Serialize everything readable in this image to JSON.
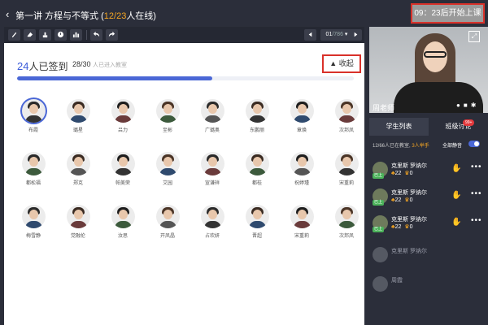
{
  "header": {
    "back_glyph": "‹",
    "title_prefix": "第一讲 方程与不等式 (",
    "online_count": "12/23",
    "title_suffix": "人在线)",
    "start_button": "09：23后开始上课"
  },
  "toolbar": {
    "tools": [
      "brush-icon",
      "eraser-icon",
      "stamp-icon",
      "timer-icon",
      "chart-icon",
      "undo-icon",
      "redo-icon"
    ],
    "page_current": "01",
    "page_total": "/786"
  },
  "board": {
    "signed_count": "24",
    "signed_label": "人已签到",
    "entered_count": "28/30",
    "entered_label": "人已进入教室",
    "collapse_label": "收起",
    "progress": 0.58,
    "students": [
      "布霞",
      "璐星",
      "吕力",
      "至彬",
      "广璐奥",
      "东鹏丽",
      "章焕",
      "次邦凤",
      "都松福",
      "郑克",
      "帕美荣",
      "艾园",
      "宣谦祥",
      "都桂",
      "祝婷瑾",
      "宋重莉",
      "梅雪静",
      "党融伦",
      "汝思",
      "开凤晶",
      "占欢妍",
      "晋超",
      "宋重莉",
      "次邦凤"
    ]
  },
  "panel": {
    "teacher_name": "周老师",
    "tab_students": "学生列表",
    "tab_discuss": "班级讨论",
    "discuss_badge": "99+",
    "online_text": "12/66人已在教室,",
    "hands_text": "3人举手",
    "mute_label": "全部静音",
    "list": [
      {
        "name": "克里斯  罗纳尔",
        "tag": "已上",
        "likes": "22",
        "cups": "0",
        "raised": true
      },
      {
        "name": "克里斯  罗纳尔",
        "tag": "已上",
        "likes": "22",
        "cups": "0",
        "raised": true
      },
      {
        "name": "克里斯  罗纳尔",
        "tag": "已上",
        "likes": "22",
        "cups": "0",
        "raised": true
      },
      {
        "name": "克里斯  罗纳尔",
        "tag": "",
        "likes": "",
        "cups": "",
        "raised": false
      },
      {
        "name": "周霞",
        "tag": "",
        "likes": "",
        "cups": "",
        "raised": false
      }
    ]
  },
  "colors": {
    "accent": "#4a67d6",
    "highlight": "#f5a623",
    "alert": "#d9312a"
  }
}
